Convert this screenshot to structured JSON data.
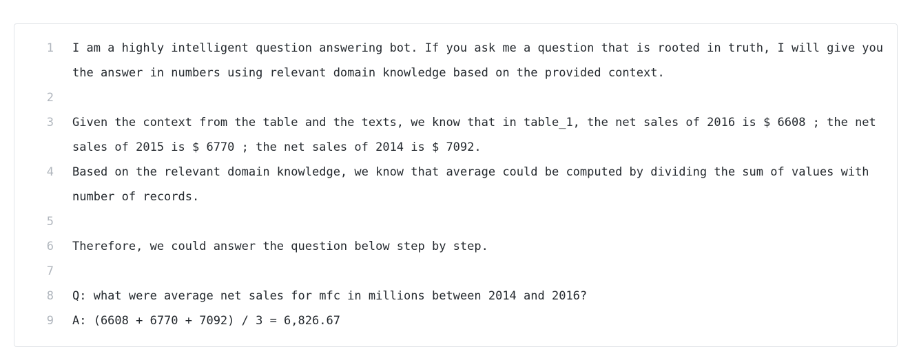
{
  "code_view": {
    "lines": [
      {
        "number": "1",
        "text": "I am a highly intelligent question answering bot. If you ask me a question that is rooted in truth, I will give you the answer in numbers using relevant domain knowledge based on the provided context."
      },
      {
        "number": "2",
        "text": ""
      },
      {
        "number": "3",
        "text": "Given the context from the table and the texts, we know that in table_1, the net sales of 2016 is $ 6608 ; the net sales of 2015 is $ 6770 ; the net sales of 2014 is $ 7092."
      },
      {
        "number": "4",
        "text": "Based on the relevant domain knowledge, we know that average could be computed by dividing the sum of values with number of records."
      },
      {
        "number": "5",
        "text": ""
      },
      {
        "number": "6",
        "text": "Therefore, we could answer the question below step by step."
      },
      {
        "number": "7",
        "text": ""
      },
      {
        "number": "8",
        "text": "Q: what were average net sales for mfc in millions between 2014 and 2016?"
      },
      {
        "number": "9",
        "text": "A: (6608 + 6770 + 7092) / 3 = 6,826.67"
      }
    ]
  }
}
